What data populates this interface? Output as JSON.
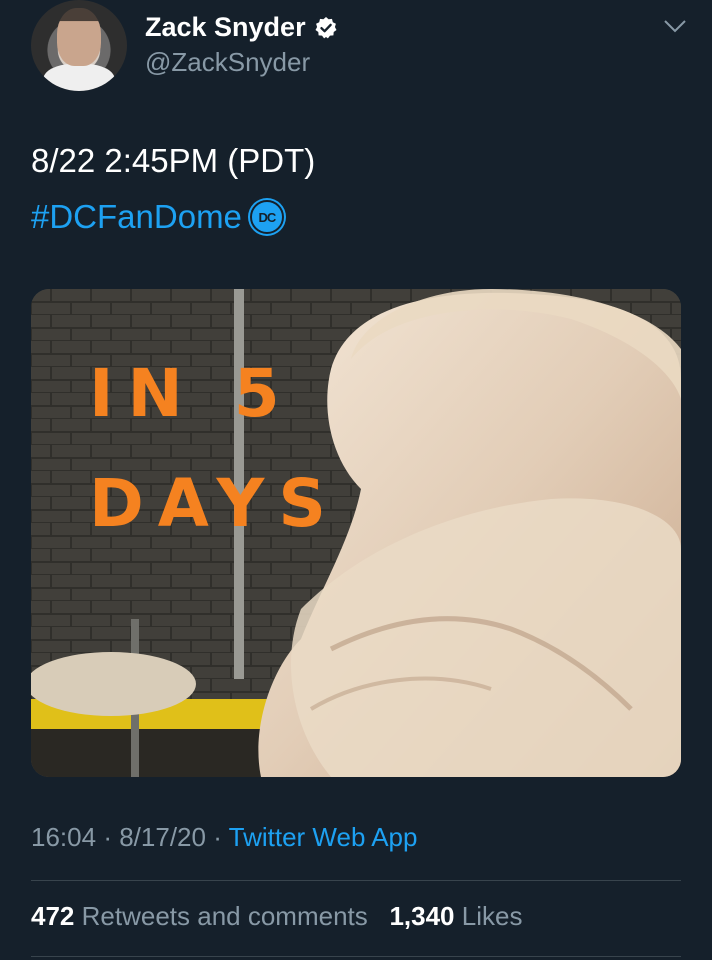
{
  "author": {
    "name": "Zack Snyder",
    "handle": "@ZackSnyder"
  },
  "tweet": {
    "line1": "8/22 2:45PM (PDT)",
    "hashtag": "#DCFanDome",
    "hashtag_badge": "DC"
  },
  "media": {
    "text_line1": "IN 5",
    "text_line2": "DAYS",
    "text_color": "#f58220"
  },
  "meta": {
    "time": "16:04",
    "separator": "·",
    "date": "8/17/20",
    "source": "Twitter Web App"
  },
  "stats": {
    "retweets_count": "472",
    "retweets_label": "Retweets and comments",
    "likes_count": "1,340",
    "likes_label": "Likes"
  },
  "colors": {
    "background": "#15202b",
    "accent": "#1da1f2",
    "secondary_text": "#8899a6"
  },
  "icons": [
    "verified-badge-icon",
    "chevron-down-icon",
    "dc-logo-icon"
  ]
}
